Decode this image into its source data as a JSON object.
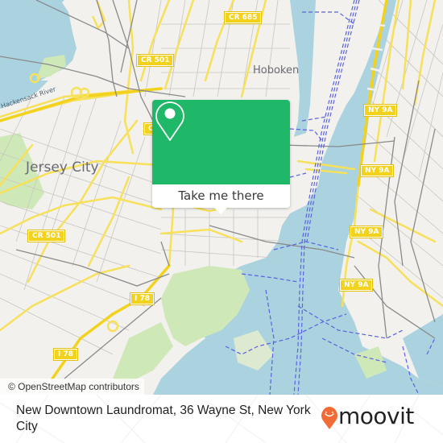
{
  "map": {
    "place_labels": [
      {
        "id": "jersey-city",
        "text": "Jersey City"
      },
      {
        "id": "hoboken",
        "text": "Hoboken"
      }
    ],
    "water_labels": [
      {
        "id": "hackensack-river",
        "text": "Hackensack River"
      }
    ],
    "road_shields": [
      {
        "id": "cr-685",
        "text": "CR 685"
      },
      {
        "id": "cr-501-north",
        "text": "CR 501"
      },
      {
        "id": "cr-501-west",
        "text": "CR 501"
      },
      {
        "id": "cr-partial",
        "text": "C"
      },
      {
        "id": "ny-9a-1",
        "text": "NY 9A"
      },
      {
        "id": "ny-9a-2",
        "text": "NY 9A"
      },
      {
        "id": "ny-9a-3",
        "text": "NY 9A"
      },
      {
        "id": "ny-9a-4",
        "text": "NY 9A"
      },
      {
        "id": "i-78-1",
        "text": "I 78"
      },
      {
        "id": "i-78-2",
        "text": "I 78"
      }
    ],
    "colors": {
      "water": "#aad3df",
      "land": "#f2f1ee",
      "park": "#cfe8b8",
      "road_major": "#f7e05a",
      "road_minor": "#c9c6c0",
      "rail": "#8a8a8a",
      "ferry": "#5a62e0"
    }
  },
  "popup": {
    "action_label": "Take me there",
    "icon": "map-pin-icon",
    "color": "#1fb768"
  },
  "attribution": "© OpenStreetMap contributors",
  "footer": {
    "address": "New Downtown Laundromat, 36 Wayne St, New York City",
    "brand": "moovit",
    "brand_icon": "moovit-pin-smile-icon",
    "brand_color": "#f26a36"
  }
}
